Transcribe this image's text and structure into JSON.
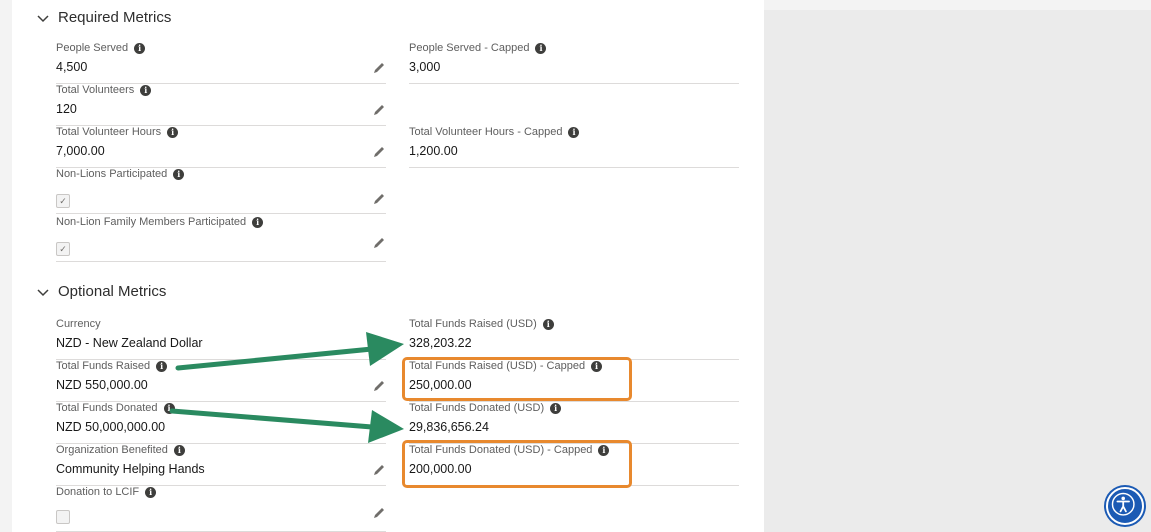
{
  "sections": {
    "required": {
      "title": "Required Metrics"
    },
    "optional": {
      "title": "Optional Metrics"
    }
  },
  "required_fields": {
    "people_served": {
      "label": "People Served",
      "value": "4,500"
    },
    "people_served_capped": {
      "label": "People Served - Capped",
      "value": "3,000"
    },
    "total_volunteers": {
      "label": "Total Volunteers",
      "value": "120"
    },
    "total_volunteer_hours": {
      "label": "Total Volunteer Hours",
      "value": "7,000.00"
    },
    "total_volunteer_hours_capped": {
      "label": "Total Volunteer Hours - Capped",
      "value": "1,200.00"
    },
    "non_lions_participated": {
      "label": "Non-Lions Participated",
      "checked": true
    },
    "non_lion_family": {
      "label": "Non-Lion Family Members Participated",
      "checked": true
    }
  },
  "optional_fields": {
    "currency": {
      "label": "Currency",
      "value": "NZD - New Zealand Dollar"
    },
    "total_funds_raised_usd": {
      "label": "Total Funds Raised (USD)",
      "value": "328,203.22"
    },
    "total_funds_raised": {
      "label": "Total Funds Raised",
      "value": "NZD 550,000.00"
    },
    "total_funds_raised_usd_capped": {
      "label": "Total Funds Raised (USD) - Capped",
      "value": "250,000.00"
    },
    "total_funds_donated": {
      "label": "Total Funds Donated",
      "value": "NZD 50,000,000.00"
    },
    "total_funds_donated_usd": {
      "label": "Total Funds Donated (USD)",
      "value": "29,836,656.24"
    },
    "organization_benefited": {
      "label": "Organization Benefited",
      "value": "Community Helping Hands"
    },
    "total_funds_donated_usd_capped": {
      "label": "Total Funds Donated (USD) - Capped",
      "value": "200,000.00"
    },
    "donation_to_lcif": {
      "label": "Donation to LCIF",
      "checked": false
    }
  },
  "icons": {
    "info": "info-icon",
    "edit": "pencil-icon",
    "collapse": "chevron-down-icon",
    "accessibility": "accessibility-icon"
  },
  "colors": {
    "highlight_box": "#e8892e",
    "annotation_arrow": "#2a8a60",
    "accessibility_button": "#1b5ab4"
  }
}
